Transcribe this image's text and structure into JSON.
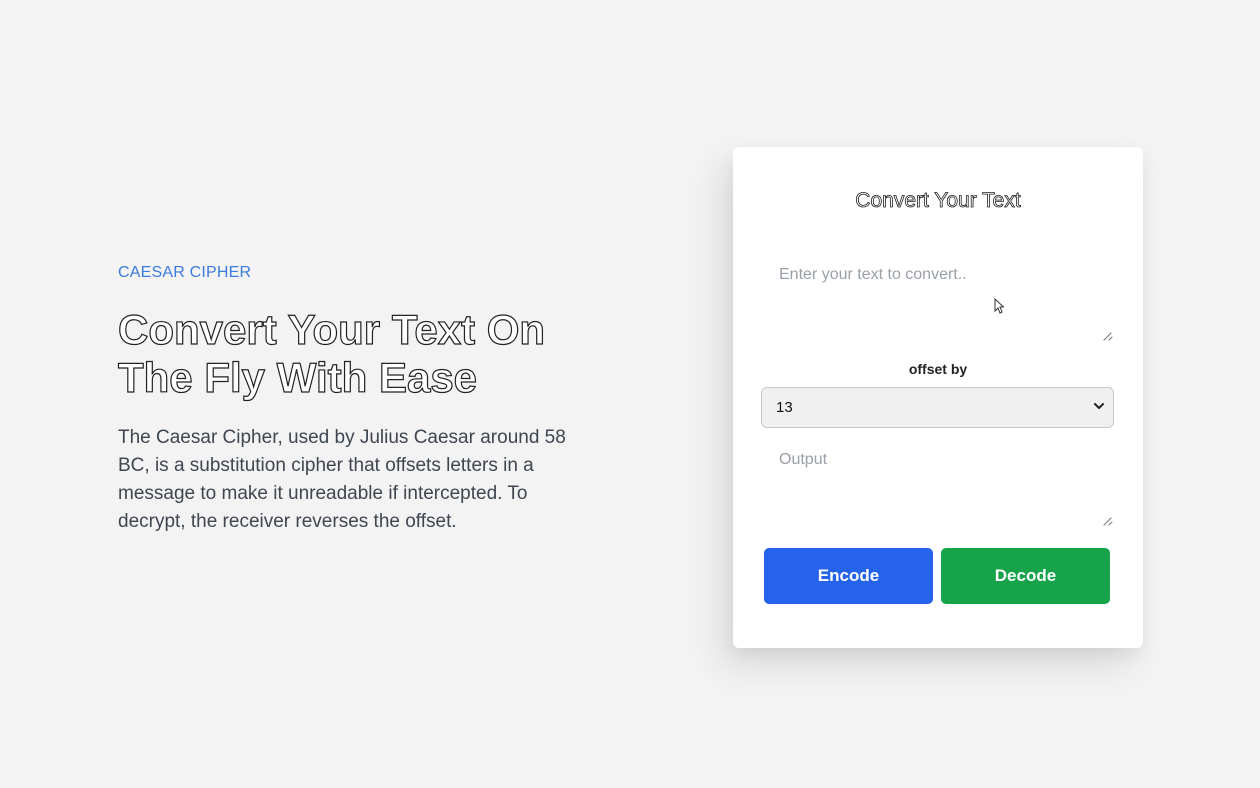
{
  "hero": {
    "eyebrow": "CAESAR CIPHER",
    "headline": "Convert Your Text On The Fly With Ease",
    "description": "The Caesar Cipher, used by Julius Caesar around 58 BC, is a substitution cipher that offsets letters in a message to make it unreadable if intercepted. To decrypt, the receiver reverses the offset."
  },
  "card": {
    "title": "Convert Your Text",
    "input": {
      "placeholder": "Enter your text to convert..",
      "value": ""
    },
    "offset_label": "offset by",
    "offset_select": {
      "value": "13"
    },
    "output": {
      "placeholder": "Output",
      "value": ""
    },
    "encode_label": "Encode",
    "decode_label": "Decode"
  },
  "colors": {
    "eyebrow": "#3b7bdc",
    "encode_button": "#2563eb",
    "decode_button": "#16a34a",
    "background": "#f3f3f3"
  },
  "icons": {
    "select_chevron": "chevron-down-icon",
    "cursor": "mouse-pointer-icon"
  }
}
